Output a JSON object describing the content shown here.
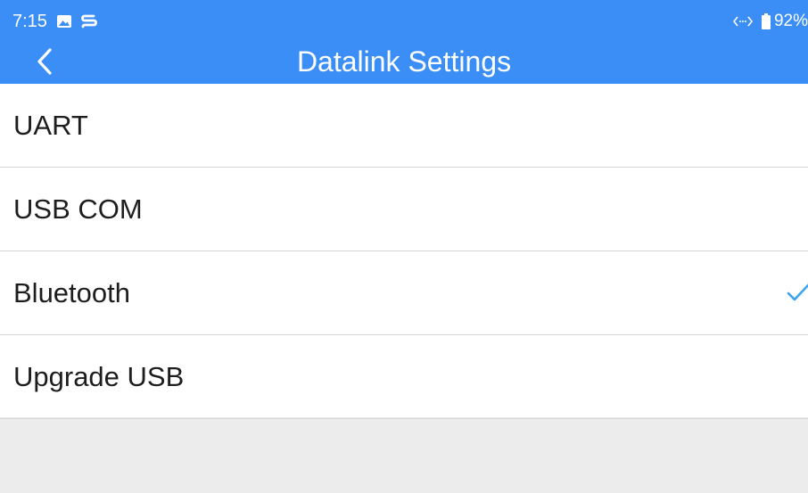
{
  "colors": {
    "header_background": "#3a8ef6",
    "header_text": "#ffffff",
    "list_background": "#ffffff",
    "divider": "#d5d5d5",
    "page_background": "#ececec",
    "check_accent": "#3aa3f2",
    "item_text": "#1d1d1d"
  },
  "status_bar": {
    "time": "7:15",
    "icons": [
      "image-icon",
      "s-app-icon",
      "data-transfer-icon",
      "battery-icon"
    ],
    "battery": "92%"
  },
  "header": {
    "back_icon": "chevron-left-icon",
    "title": "Datalink Settings"
  },
  "settings": {
    "items": [
      {
        "label": "UART",
        "selected": false
      },
      {
        "label": "USB COM",
        "selected": false
      },
      {
        "label": "Bluetooth",
        "selected": true
      },
      {
        "label": "Upgrade USB",
        "selected": false
      }
    ],
    "selected_icon": "checkmark-icon"
  }
}
